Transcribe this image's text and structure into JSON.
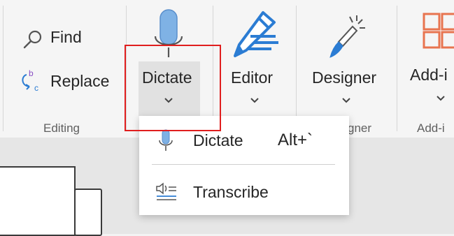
{
  "ribbon": {
    "editing": {
      "find_label": "Find",
      "replace_label": "Replace",
      "group_label": "Editing"
    },
    "dictate": {
      "button_label": "Dictate"
    },
    "editor": {
      "button_label": "Editor"
    },
    "designer": {
      "button_label": "Designer",
      "group_label_partial": "gner"
    },
    "addins": {
      "button_label": "Add-i",
      "group_label": "Add-i"
    }
  },
  "dropdown": {
    "items": [
      {
        "label": "Dictate",
        "shortcut": "Alt+`"
      },
      {
        "label": "Transcribe"
      }
    ]
  },
  "colors": {
    "highlight": "#e01e1e",
    "mic_blue": "#7fb2e5",
    "editor_blue": "#2b7cd3",
    "addins_orange": "#e8744f"
  }
}
